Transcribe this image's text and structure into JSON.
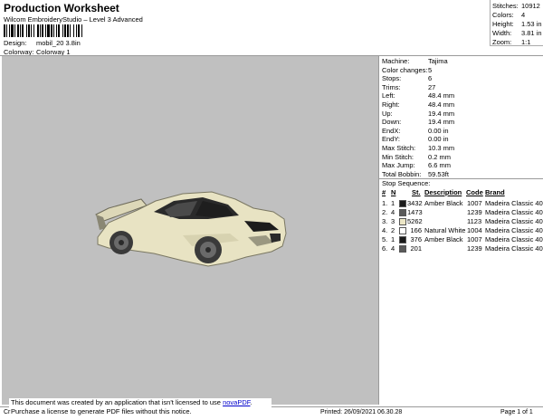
{
  "header": {
    "title": "Production Worksheet",
    "subtitle": "Wilcom EmbroideryStudio – Level 3 Advanced",
    "design_label": "Design:",
    "design_value": "mobil_20 3.8in",
    "colorway_label": "Colorway:",
    "colorway_value": "Colorway 1"
  },
  "summary": {
    "stitches_label": "Stitches:",
    "stitches_value": "10912",
    "colors_label": "Colors:",
    "colors_value": "4",
    "height_label": "Height:",
    "height_value": "1.53 in",
    "width_label": "Width:",
    "width_value": "3.81 in",
    "zoom_label": "Zoom:",
    "zoom_value": "1:1"
  },
  "machine_info": [
    {
      "label": "Machine:",
      "value": "Tajima"
    },
    {
      "label": "Color changes:",
      "value": "5"
    },
    {
      "label": "Stops:",
      "value": "6"
    },
    {
      "label": "Trims:",
      "value": "27"
    },
    {
      "label": "Left:",
      "value": "48.4 mm"
    },
    {
      "label": "Right:",
      "value": "48.4 mm"
    },
    {
      "label": "Up:",
      "value": "19.4 mm"
    },
    {
      "label": "Down:",
      "value": "19.4 mm"
    },
    {
      "label": "EndX:",
      "value": "0.00 in"
    },
    {
      "label": "EndY:",
      "value": "0.00 in"
    },
    {
      "label": "Max Stitch:",
      "value": "10.3 mm"
    },
    {
      "label": "Min Stitch:",
      "value": "0.2 mm"
    },
    {
      "label": "Max Jump:",
      "value": "6.6 mm"
    },
    {
      "label": "Total Bobbin:",
      "value": "59.53ft"
    }
  ],
  "stop_sequence": {
    "title": "Stop Sequence:",
    "headers": {
      "num": "#",
      "n": "N",
      "st": "St.",
      "desc": "Description",
      "code": "Code",
      "brand": "Brand"
    },
    "rows": [
      {
        "num": "1.",
        "n": "1",
        "color": "#1a1a1a",
        "st": "3432",
        "desc": "Amber Black",
        "code": "1007",
        "brand": "Madeira Classic 40"
      },
      {
        "num": "2.",
        "n": "4",
        "color": "#5a5a5a",
        "st": "1473",
        "desc": "",
        "code": "1239",
        "brand": "Madeira Classic 40"
      },
      {
        "num": "3.",
        "n": "3",
        "color": "#ece6c6",
        "st": "5262",
        "desc": "",
        "code": "1123",
        "brand": "Madeira Classic 40"
      },
      {
        "num": "4.",
        "n": "2",
        "color": "#ffffff",
        "st": "166",
        "desc": "Natural White",
        "code": "1004",
        "brand": "Madeira Classic 40"
      },
      {
        "num": "5.",
        "n": "1",
        "color": "#1a1a1a",
        "st": "376",
        "desc": "Amber Black",
        "code": "1007",
        "brand": "Madeira Classic 40"
      },
      {
        "num": "6.",
        "n": "4",
        "color": "#5a5a5a",
        "st": "201",
        "desc": "",
        "code": "1239",
        "brand": "Madeira Classic 40"
      }
    ]
  },
  "notice": {
    "line1_prefix": "This document was created by an application that isn't licensed to use ",
    "link": "novaPDF",
    "line1_suffix": ".",
    "line2": "Purchase a license to generate PDF files without this notice."
  },
  "footer": {
    "left": "Cr",
    "printed": "Printed: 26/09/2021 06.30.28",
    "page": "Page 1 of 1"
  },
  "colors": {
    "design_background": "#c0c0c0",
    "car_body": "#e8e3c3"
  }
}
